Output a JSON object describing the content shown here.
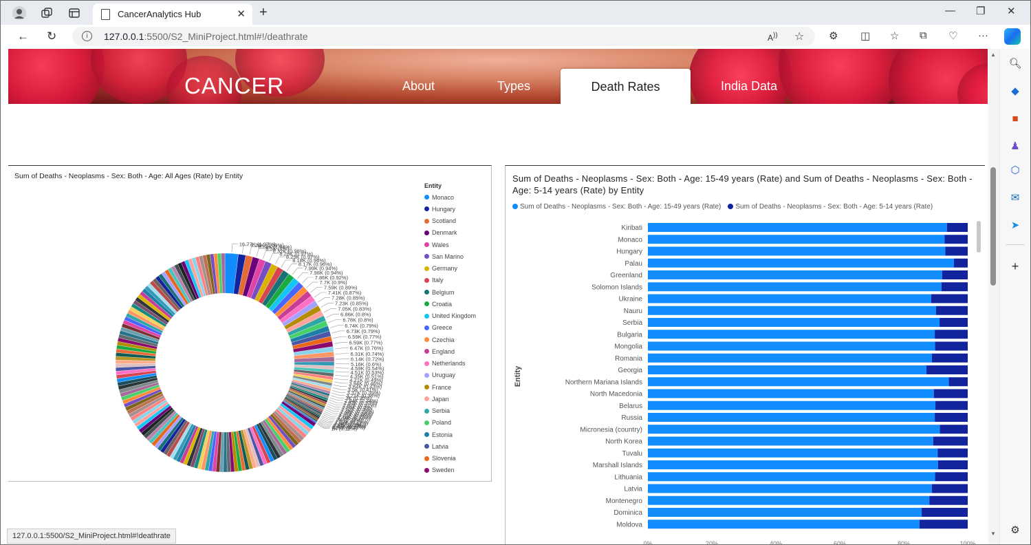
{
  "browser": {
    "tab_title": "CancerAnalytics Hub",
    "url_host": "127.0.0.1",
    "url_rest": ":5500/S2_MiniProject.html#!/deathrate",
    "status_url": "127.0.0.1:5500/S2_MiniProject.html#!deathrate"
  },
  "site": {
    "logo": "CANCER",
    "nav": [
      "About",
      "Types",
      "Death Rates",
      "India Data"
    ],
    "active": "Death Rates"
  },
  "donut": {
    "title": "Sum of Deaths - Neoplasms - Sex: Both - Age: All Ages (Rate) by Entity",
    "legend_title": "Entity",
    "legend": [
      {
        "name": "Monaco",
        "color": "#118dff"
      },
      {
        "name": "Hungary",
        "color": "#12239e"
      },
      {
        "name": "Scotland",
        "color": "#e66c37"
      },
      {
        "name": "Denmark",
        "color": "#6b007b"
      },
      {
        "name": "Wales",
        "color": "#e044a7"
      },
      {
        "name": "San Marino",
        "color": "#744ec2"
      },
      {
        "name": "Germany",
        "color": "#d9b300"
      },
      {
        "name": "Italy",
        "color": "#d64550"
      },
      {
        "name": "Belgium",
        "color": "#197278"
      },
      {
        "name": "Croatia",
        "color": "#1aab40"
      },
      {
        "name": "United Kingdom",
        "color": "#15c6f4"
      },
      {
        "name": "Greece",
        "color": "#4766ff"
      },
      {
        "name": "Czechia",
        "color": "#ff8c3c"
      },
      {
        "name": "England",
        "color": "#c83d95"
      },
      {
        "name": "Netherlands",
        "color": "#ff6fc3"
      },
      {
        "name": "Uruguay",
        "color": "#a5a1ff"
      },
      {
        "name": "France",
        "color": "#b58c00"
      },
      {
        "name": "Japan",
        "color": "#ffa39e"
      },
      {
        "name": "Serbia",
        "color": "#30a6a6"
      },
      {
        "name": "Poland",
        "color": "#47d16b"
      },
      {
        "name": "Estonia",
        "color": "#1d7fa8"
      },
      {
        "name": "Latvia",
        "color": "#4b57a6"
      },
      {
        "name": "Slovenia",
        "color": "#e8671a"
      },
      {
        "name": "Sweden",
        "color": "#8c0a6e"
      }
    ],
    "labels_right": [
      "16.77K (1.97%)",
      "9.26K (1.09%)",
      "8.84K (1.04%)",
      "8.5K (1%)",
      "8.32K (0.98%)",
      "8.28K (0.97%)",
      "8.25K (0.97%)",
      "8.18K (0.96%)",
      "8.17K (0.96%)",
      "7.99K (0.94%)",
      "7.98K (0.94%)",
      "7.86K (0.92%)",
      "7.7K (0.9%)",
      "7.59K (0.89%)",
      "7.41K (0.87%)",
      "7.28K (0.85%)",
      "7.23K (0.85%)",
      "7.05K (0.83%)",
      "6.86K (0.8%)",
      "6.78K (0.8%)",
      "6.74K (0.79%)",
      "6.73K (0.79%)",
      "6.59K (0.77%)",
      "6.59K (0.77%)",
      "6.47K (0.76%)",
      "6.31K (0.74%)"
    ],
    "labels_bottom": [
      "6.14K (0.72%)",
      "5.16K (0.6%)"
    ],
    "labels_left": [
      "4.59K (0.54%)",
      "4.51K (0.53%)",
      "4.35K (0.51%)",
      "4.21K (0.49%)",
      "3.94K (0.46%)",
      "3.64K (0.43%)",
      "3.5K (0.41%)",
      "3.37K (0.39%)",
      "3.21K (0.38%)",
      "3K (0.35%)",
      "2.94K (0.34%)",
      "2.83K (0.33%)",
      "2.62K (0.31%)",
      "2.55K (0.3%)",
      "2.52K (0.3%)",
      "2.48K (0.29%)",
      "2.36K (0.28%)",
      "2.21K (0.26%)",
      "2.16K (0.25%)",
      "2.08K (0.24%)",
      "2K (0.23%)",
      "1.93K (0.23%)",
      "1.84K (0.22%)",
      "1.7K (0.2%)",
      "1.57K (0.18%)"
    ],
    "labels_top": [
      "1.42K (0.17%)",
      "1.27K (0.15%)",
      "1K (0.12%)"
    ]
  },
  "bars": {
    "title": "Sum of Deaths - Neoplasms - Sex: Both - Age: 15-49 years (Rate) and Sum of Deaths - Neoplasms - Sex: Both - Age: 5-14 years (Rate) by Entity",
    "series": [
      "Sum of Deaths - Neoplasms - Sex: Both - Age: 15-49 years (Rate)",
      "Sum of Deaths - Neoplasms - Sex: Both - Age: 5-14 years (Rate)"
    ],
    "colors": [
      "#118dff",
      "#12239e"
    ],
    "axis_title": "Entity",
    "entities": [
      "Kiribati",
      "Monaco",
      "Hungary",
      "Palau",
      "Greenland",
      "Solomon Islands",
      "Ukraine",
      "Nauru",
      "Serbia",
      "Bulgaria",
      "Mongolia",
      "Romania",
      "Georgia",
      "Northern Mariana Islands",
      "North Macedonia",
      "Belarus",
      "Russia",
      "Micronesia (country)",
      "North Korea",
      "Tuvalu",
      "Marshall Islands",
      "Lithuania",
      "Latvia",
      "Montenegro",
      "Dominica",
      "Moldova"
    ],
    "share_15_49": [
      0.935,
      0.928,
      0.93,
      0.957,
      0.92,
      0.918,
      0.886,
      0.901,
      0.912,
      0.897,
      0.898,
      0.888,
      0.871,
      0.941,
      0.894,
      0.899,
      0.897,
      0.913,
      0.892,
      0.906,
      0.907,
      0.898,
      0.888,
      0.88,
      0.856,
      0.849
    ]
  }
}
